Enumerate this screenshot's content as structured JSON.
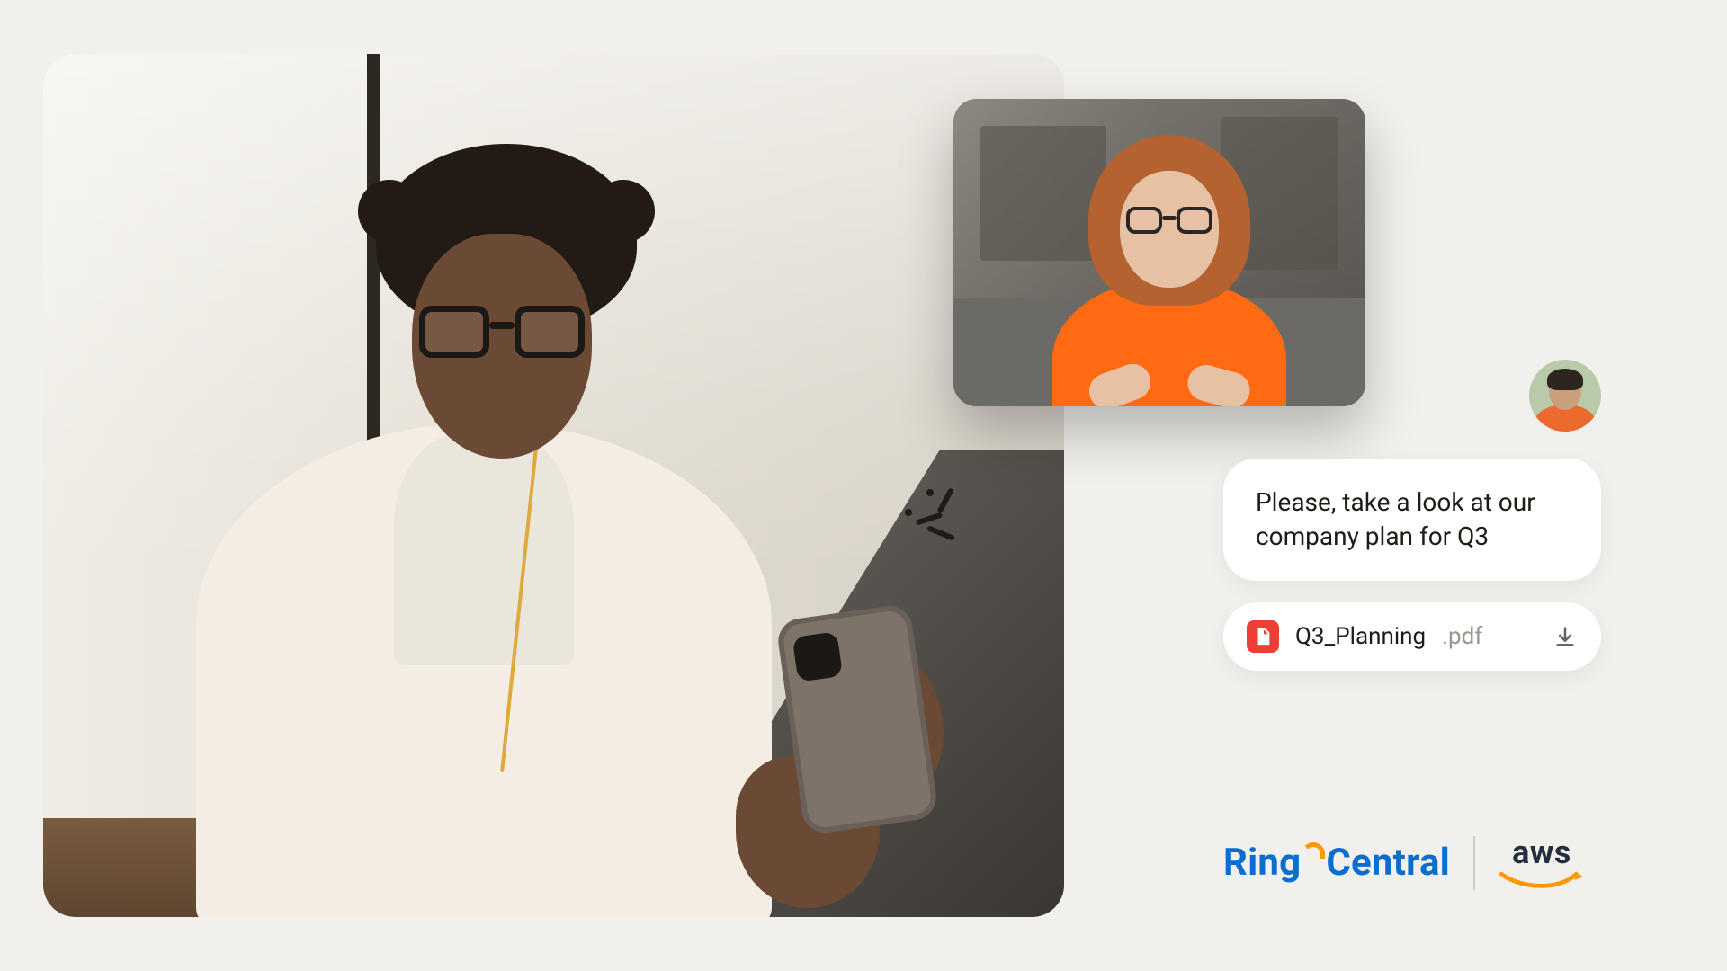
{
  "chat": {
    "message_text": "Please, take a look at our company plan for Q3",
    "attachment": {
      "filename": "Q3_Planning",
      "extension": ".pdf"
    }
  },
  "logos": {
    "ringcentral_part1": "Ring",
    "ringcentral_part2": "Central",
    "aws_label": "aws"
  },
  "icons": {
    "pdf": "pdf-icon",
    "download": "download-icon",
    "notification_burst": "notification-burst-icon"
  }
}
